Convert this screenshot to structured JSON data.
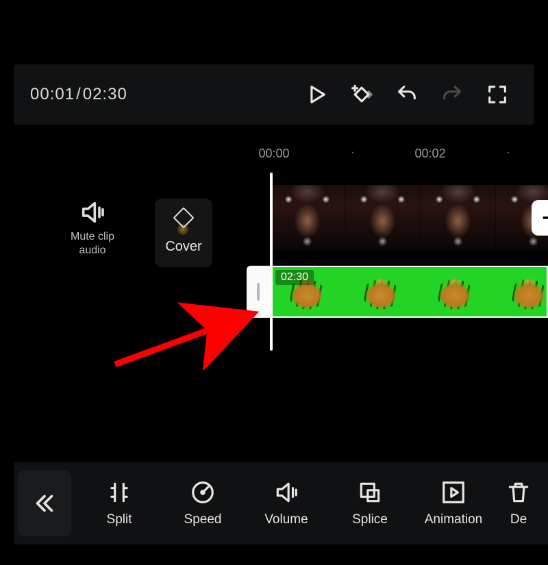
{
  "playback": {
    "current": "00:01",
    "separator": "/",
    "total": "02:30"
  },
  "timeline_ruler": {
    "t0": "00:00",
    "t1": "00:02"
  },
  "left_controls": {
    "mute_line1": "Mute clip",
    "mute_line2": "audio",
    "cover_label": "Cover"
  },
  "tracks": {
    "overlay_duration": "02:30"
  },
  "toolbar": {
    "back": "Back",
    "items": [
      {
        "id": "split",
        "label": "Split"
      },
      {
        "id": "speed",
        "label": "Speed"
      },
      {
        "id": "volume",
        "label": "Volume"
      },
      {
        "id": "splice",
        "label": "Splice"
      },
      {
        "id": "animation",
        "label": "Animation"
      },
      {
        "id": "delete",
        "label": "De"
      }
    ]
  },
  "icons": {
    "play": "play-icon",
    "keyframe": "add-keyframe-icon",
    "undo": "undo-icon",
    "redo": "redo-icon",
    "fullscreen": "fullscreen-icon",
    "speaker": "speaker-icon",
    "plus": "plus-icon",
    "back": "chevrons-left-icon"
  }
}
